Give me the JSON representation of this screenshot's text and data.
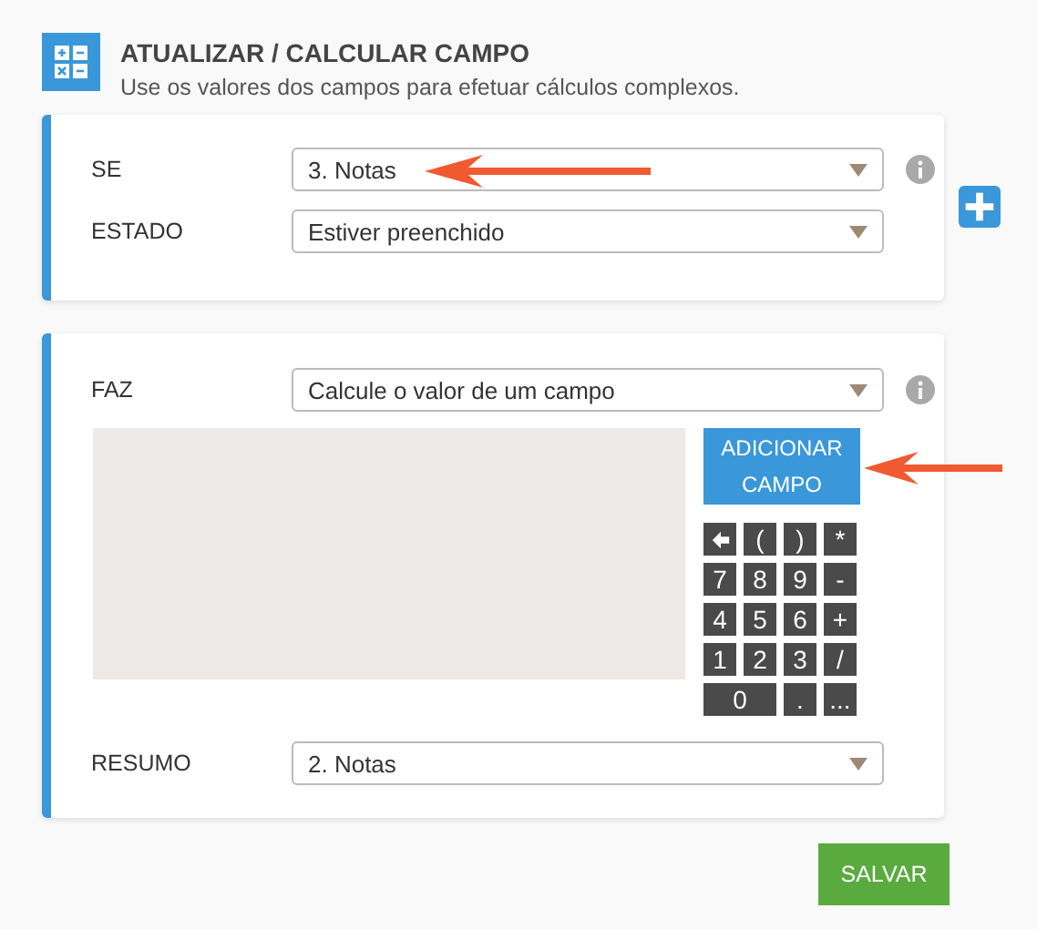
{
  "header": {
    "title": "ATUALIZAR / CALCULAR CAMPO",
    "subtitle": "Use os valores dos campos para efetuar cálculos complexos."
  },
  "condition": {
    "rows": [
      {
        "label": "SE",
        "value": "3. Notas",
        "info": true,
        "annotated": true
      },
      {
        "label": "ESTADO",
        "value": "Estiver preenchido",
        "info": false,
        "annotated": false
      }
    ]
  },
  "action": {
    "label": "FAZ",
    "value": "Calcule o valor de um campo",
    "info": true,
    "add_field_button": "ADICIONAR CAMPO",
    "keypad": [
      {
        "kind": "backspace"
      },
      {
        "kind": "key",
        "label": "("
      },
      {
        "kind": "key",
        "label": ")"
      },
      {
        "kind": "key",
        "label": "*"
      },
      {
        "kind": "key",
        "label": "7"
      },
      {
        "kind": "key",
        "label": "8"
      },
      {
        "kind": "key",
        "label": "9"
      },
      {
        "kind": "key",
        "label": "-"
      },
      {
        "kind": "key",
        "label": "4"
      },
      {
        "kind": "key",
        "label": "5"
      },
      {
        "kind": "key",
        "label": "6"
      },
      {
        "kind": "key",
        "label": "+"
      },
      {
        "kind": "key",
        "label": "1"
      },
      {
        "kind": "key",
        "label": "2"
      },
      {
        "kind": "key",
        "label": "3"
      },
      {
        "kind": "key",
        "label": "/"
      },
      {
        "kind": "wide",
        "label": "0"
      },
      {
        "kind": "key",
        "label": "."
      },
      {
        "kind": "key",
        "label": "..."
      }
    ],
    "summary_label": "RESUMO",
    "summary_value": "2. Notas"
  },
  "save_button": "SALVAR"
}
